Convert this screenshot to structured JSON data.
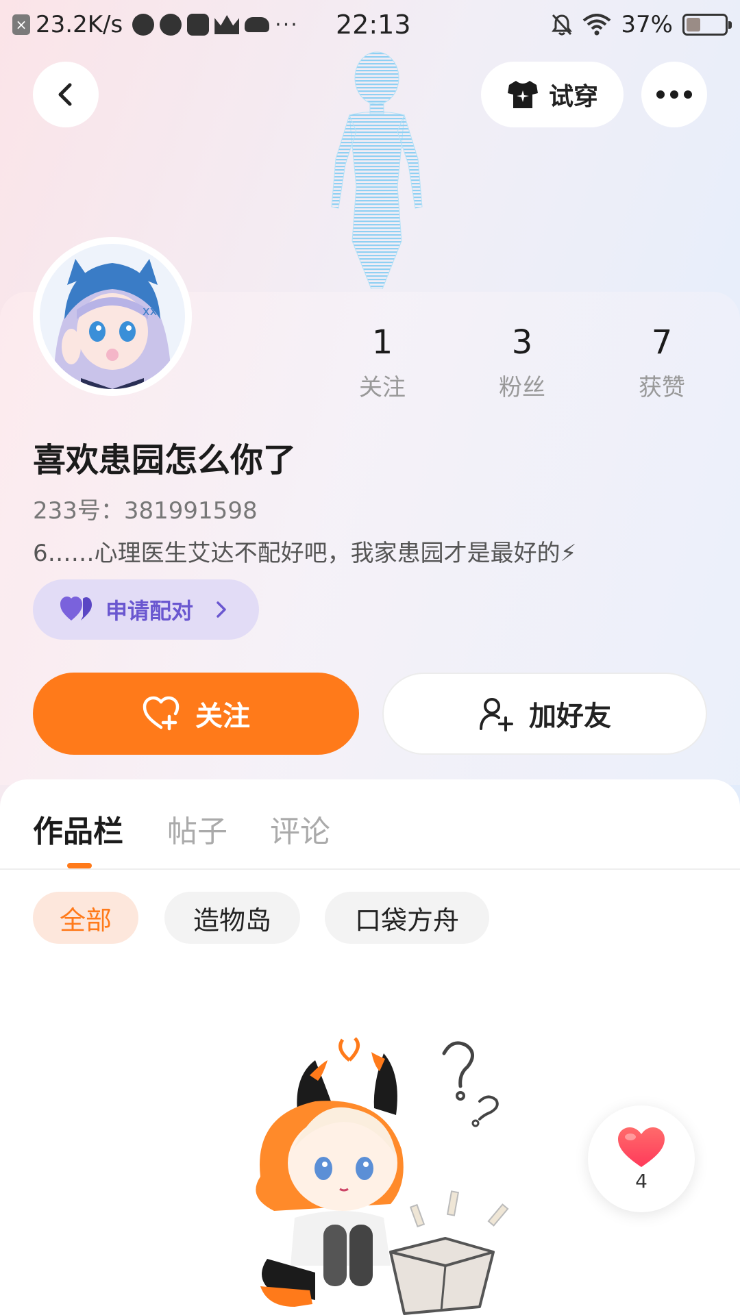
{
  "status_bar": {
    "net_speed": "23.2K/s",
    "time": "22:13",
    "battery": "37%",
    "battery_level": 0.37
  },
  "header": {
    "tryon_label": "试穿"
  },
  "profile": {
    "username": "喜欢患园怎么你了",
    "uid": "233号：381991598",
    "bio": "6……心理医生艾达不配好吧，我家患园才是最好的⚡",
    "stats": [
      {
        "value": "1",
        "label": "关注"
      },
      {
        "value": "3",
        "label": "粉丝"
      },
      {
        "value": "7",
        "label": "获赞"
      }
    ],
    "pair_label": "申请配对",
    "follow_label": "关注",
    "add_friend_label": "加好友"
  },
  "tabs": [
    "作品栏",
    "帖子",
    "评论"
  ],
  "filters": [
    "全部",
    "造物岛",
    "口袋方舟"
  ],
  "like_count": "4",
  "colors": {
    "accent": "#ff7a1a",
    "pair": "#6a57d0",
    "pair_bg": "#e2dcf6"
  }
}
